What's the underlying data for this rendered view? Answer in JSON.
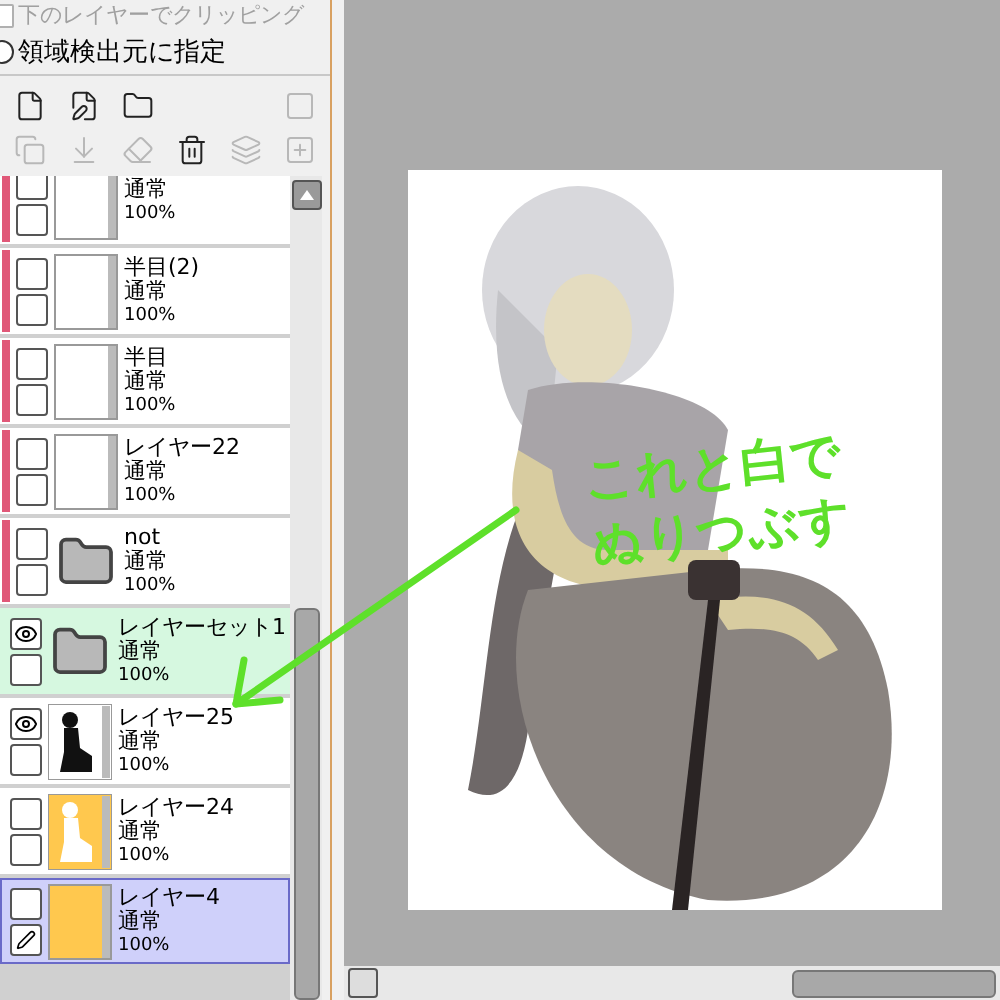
{
  "options": [
    {
      "kind": "checkbox",
      "label": "下のレイヤーでクリッピング",
      "checked": false,
      "disabled": true
    },
    {
      "kind": "radio",
      "label": "領域検出元に指定",
      "checked": false,
      "disabled": false
    }
  ],
  "toolbar": [
    [
      {
        "kind": "new-layer",
        "disabled": false
      },
      {
        "kind": "new-pen-layer",
        "disabled": false
      },
      {
        "kind": "new-folder",
        "disabled": false
      },
      {
        "kind": "mask",
        "disabled": true
      }
    ],
    [
      {
        "kind": "copy",
        "disabled": true
      },
      {
        "kind": "transfer",
        "disabled": true
      },
      {
        "kind": "erase",
        "disabled": true
      },
      {
        "kind": "delete",
        "disabled": false
      },
      {
        "kind": "merge",
        "disabled": true
      },
      {
        "kind": "add-mask",
        "disabled": true
      }
    ]
  ],
  "layers": [
    {
      "kind": "empty",
      "mode": "通常",
      "opacity": "100%",
      "visible": false,
      "editing": false,
      "selected": false,
      "highlighted": false,
      "color": "#e05878"
    },
    {
      "kind": "empty",
      "name": "半目(2)",
      "mode": "通常",
      "opacity": "100%",
      "visible": false,
      "editing": false,
      "selected": false,
      "highlighted": false,
      "color": "#e05878"
    },
    {
      "kind": "empty",
      "name": "半目",
      "mode": "通常",
      "opacity": "100%",
      "visible": false,
      "editing": false,
      "selected": false,
      "highlighted": false,
      "color": "#e05878"
    },
    {
      "kind": "empty",
      "name": "レイヤー22",
      "mode": "通常",
      "opacity": "100%",
      "visible": false,
      "editing": false,
      "selected": false,
      "highlighted": false,
      "color": "#e05878"
    },
    {
      "kind": "folder",
      "name": "not",
      "mode": "通常",
      "opacity": "100%",
      "visible": false,
      "editing": false,
      "selected": false,
      "highlighted": false,
      "color": "#e05878"
    },
    {
      "kind": "folder",
      "name": "レイヤーセット1",
      "mode": "通常",
      "opacity": "100%",
      "visible": true,
      "editing": false,
      "selected": false,
      "highlighted": true
    },
    {
      "kind": "figure",
      "name": "レイヤー25",
      "mode": "通常",
      "opacity": "100%",
      "visible": true,
      "editing": false,
      "selected": false,
      "highlighted": false
    },
    {
      "kind": "cutout",
      "name": "レイヤー24",
      "mode": "通常",
      "opacity": "100%",
      "visible": false,
      "editing": false,
      "selected": false,
      "highlighted": false
    },
    {
      "kind": "fill",
      "name": "レイヤー4",
      "mode": "通常",
      "opacity": "100%",
      "visible": false,
      "editing": true,
      "selected": true,
      "highlighted": false
    }
  ],
  "canvas": {
    "annotation": {
      "lines": [
        "これと白で",
        "ぬりつぶす"
      ],
      "color": "#5ee02a"
    }
  }
}
